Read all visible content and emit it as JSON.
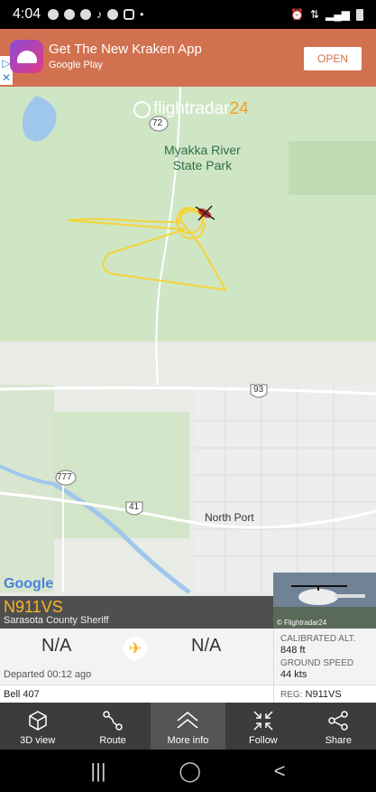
{
  "status_bar": {
    "time": "4:04"
  },
  "ad": {
    "title": "Get The New Kraken App",
    "subtitle": "Google Play",
    "cta": "OPEN"
  },
  "map": {
    "logo_main": "flightradar",
    "logo_suffix": "24",
    "park_label_line1": "Myakka River",
    "park_label_line2": "State Park",
    "city_label": "North Port",
    "road_shields": [
      "72",
      "93",
      "777",
      "41"
    ],
    "attribution": "Google"
  },
  "flight": {
    "callsign": "N911VS",
    "operator": "Sarasota County Sheriff",
    "origin": "N/A",
    "destination": "N/A",
    "departed": "Departed 00:12 ago",
    "aircraft_type": "Bell 407",
    "photo_credit": "© Flightradar24",
    "calibrated_alt_label": "CALIBRATED ALT.",
    "calibrated_alt_value": "848 ft",
    "ground_speed_label": "GROUND SPEED",
    "ground_speed_value": "44 kts",
    "reg_label": "REG:",
    "reg_value": "N911VS"
  },
  "toolbar": {
    "items": [
      {
        "label": "3D view",
        "icon": "cube-icon"
      },
      {
        "label": "Route",
        "icon": "route-icon"
      },
      {
        "label": "More info",
        "icon": "chevron-up-icon"
      },
      {
        "label": "Follow",
        "icon": "collapse-arrows-icon"
      },
      {
        "label": "Share",
        "icon": "share-icon"
      }
    ]
  },
  "colors": {
    "ad_bg": "#d1714f",
    "accent": "#f8b324",
    "track": "#f5d33a",
    "toolbar_bg": "#3c3c3c"
  }
}
